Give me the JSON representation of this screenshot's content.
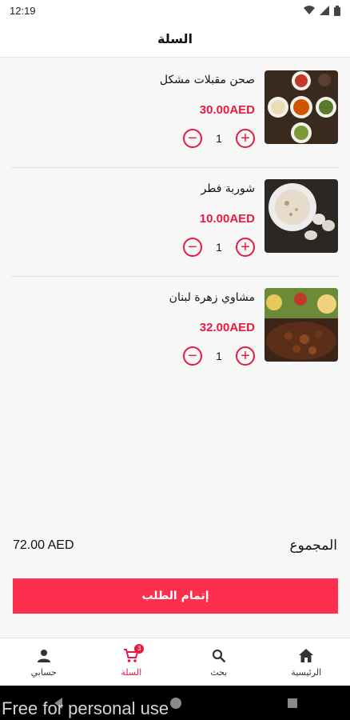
{
  "status_bar": {
    "time": "12:19",
    "wifi_icon": "wifi-icon",
    "signal_icon": "signal-icon",
    "battery_icon": "battery-icon"
  },
  "header": {
    "title": "السلة"
  },
  "cart": {
    "items": [
      {
        "name": "صحن مقبلات مشكل",
        "price": "30.00AED",
        "quantity": "1",
        "plus": "+",
        "minus": "−",
        "image_icon": "mixed-appetizers-image"
      },
      {
        "name": "شوربة فطر",
        "price": "10.00AED",
        "quantity": "1",
        "plus": "+",
        "minus": "−",
        "image_icon": "mushroom-soup-image"
      },
      {
        "name": "مشاوي زهرة لبنان",
        "price": "32.00AED",
        "quantity": "1",
        "plus": "+",
        "minus": "−",
        "image_icon": "grill-platter-image"
      }
    ]
  },
  "total": {
    "label": "المجموع",
    "amount": "72.00 AED"
  },
  "checkout": {
    "label": "إتمام الطلب"
  },
  "bottom_nav": {
    "home": {
      "label": "الرئيسية",
      "icon": "home-icon"
    },
    "search": {
      "label": "بحث",
      "icon": "search-icon"
    },
    "cart": {
      "label": "السلة",
      "icon": "cart-icon",
      "badge": "3"
    },
    "account": {
      "label": "حسابي",
      "icon": "person-icon"
    }
  },
  "colors": {
    "accent": "#e8193f",
    "button": "#fd2f4f",
    "background": "#f7f7f7"
  },
  "watermark": "Free for personal use"
}
